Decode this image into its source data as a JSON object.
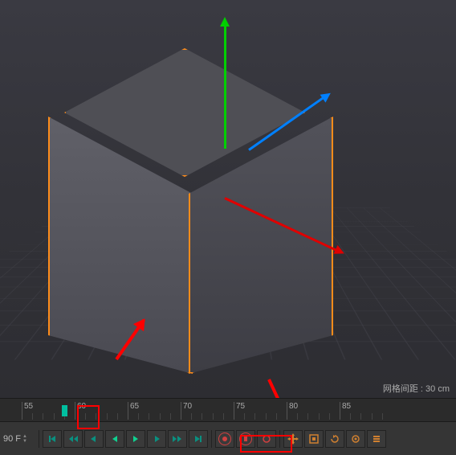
{
  "viewport": {
    "grid_label": "网格间距 : 30 cm"
  },
  "timeline": {
    "ticks": [
      "55",
      "60",
      "65",
      "70",
      "75",
      "80",
      "85"
    ],
    "keyframe_at": 60
  },
  "playback": {
    "current_frame": "90 F"
  },
  "icons": {
    "first": "first-frame",
    "prev": "prev-frame",
    "play_rev": "play-reverse",
    "play": "play",
    "next": "next-frame",
    "last": "last-frame",
    "record": "record",
    "autokey": "autokey",
    "key_pos": "key-position",
    "key_rot": "key-rotation",
    "key_scl": "key-scale"
  }
}
